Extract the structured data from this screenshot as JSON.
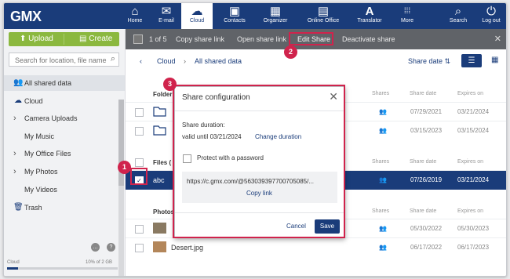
{
  "app": {
    "logo": "GMX"
  },
  "nav": [
    {
      "label": "Home",
      "icon": "home-icon",
      "glyph": "⌂"
    },
    {
      "label": "E-mail",
      "icon": "envelope-icon",
      "glyph": "✉"
    },
    {
      "label": "Cloud",
      "icon": "cloud-icon",
      "glyph": "☁",
      "active": true
    },
    {
      "label": "Contacts",
      "icon": "contacts-icon",
      "glyph": "▣"
    },
    {
      "label": "Organizer",
      "icon": "calendar-icon",
      "glyph": "▦"
    },
    {
      "label": "Online Office",
      "icon": "office-icon",
      "glyph": "▤"
    },
    {
      "label": "Translator",
      "icon": "translate-icon",
      "glyph": "A"
    },
    {
      "label": "More",
      "icon": "grid-icon",
      "glyph": "⁞⁞⁞"
    },
    {
      "label": "Search",
      "icon": "search-icon",
      "glyph": "⌕"
    },
    {
      "label": "Log out",
      "icon": "power-icon",
      "glyph": "⏻"
    }
  ],
  "sidebar": {
    "upload_label": "Upload",
    "create_label": "Create",
    "search_placeholder": "Search for location, file name",
    "items": [
      {
        "label": "All shared data",
        "icon": "people-icon",
        "glyph": "👥",
        "selected": true
      },
      {
        "label": "Cloud",
        "icon": "cloud-icon",
        "glyph": "☁"
      },
      {
        "label": "Camera Uploads",
        "expandable": true
      },
      {
        "label": "My Music"
      },
      {
        "label": "My Office Files",
        "expandable": true
      },
      {
        "label": "My Photos",
        "expandable": true
      },
      {
        "label": "My Videos"
      },
      {
        "label": "Trash",
        "icon": "trash-icon",
        "glyph": "🗑"
      }
    ],
    "storage_label": "Cloud",
    "storage_value": "10% of 2 GB",
    "storage_fraction": 0.1
  },
  "actionbar": {
    "count": "1 of 5",
    "copy_link": "Copy share link",
    "open_link": "Open share link",
    "edit_share": "Edit Share",
    "deactivate": "Deactivate share"
  },
  "breadcrumb": {
    "root": "Cloud",
    "current": "All shared data",
    "sort_label": "Share date ⇅"
  },
  "columns": {
    "shares": "Shares",
    "share_date": "Share date",
    "expires_on": "Expires on"
  },
  "sections": {
    "folders": {
      "title": "Folders"
    },
    "files": {
      "title": "Files ("
    },
    "photos": {
      "title": "Photos"
    }
  },
  "rows": {
    "folder1": {
      "share_date": "07/29/2021",
      "expires_on": "03/21/2024"
    },
    "folder2": {
      "share_date": "03/15/2023",
      "expires_on": "03/15/2024"
    },
    "file1": {
      "name": "abc",
      "share_date": "07/26/2019",
      "expires_on": "03/21/2024"
    },
    "photo1": {
      "share_date": "05/30/2022",
      "expires_on": "05/30/2023"
    },
    "photo2": {
      "name": "Desert.jpg",
      "share_date": "06/17/2022",
      "expires_on": "06/17/2023"
    }
  },
  "dialog": {
    "title": "Share configuration",
    "duration_label": "Share duration:",
    "valid_until": "valid until 03/21/2024",
    "change_duration": "Change duration",
    "protect_label": "Protect with a password",
    "url": "https://c.gmx.com/@563039397700705085/...",
    "copy_link": "Copy link",
    "cancel": "Cancel",
    "save": "Save"
  },
  "badges": {
    "b1": "1",
    "b2": "2",
    "b3": "3"
  },
  "colors": {
    "brand": "#1a3c7a",
    "accent_green": "#8bb83f",
    "highlight": "#d0234c"
  }
}
